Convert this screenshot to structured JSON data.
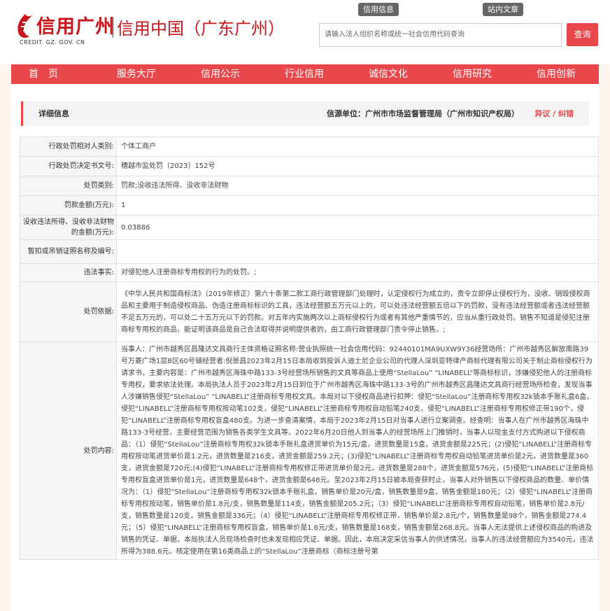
{
  "header": {
    "logo_text": "信用广州",
    "logo_sub": "CREDIT. GZ. GOV. CN",
    "site_title": "信用中国（广东广州）",
    "pill_left": "信用信息",
    "pill_right": "站内文章",
    "search_placeholder": "请输入法人组织名称或统一社会信用代码查询",
    "search_button": "查询"
  },
  "nav": [
    "首　页",
    "服务大厅",
    "信用公示",
    "行业信用",
    "诚信文化",
    "信用研究",
    "信用创新"
  ],
  "detail": {
    "title": "详细信息",
    "source_label": "信源单位：广州市市场监督管理局（广州市知识产权局）",
    "objection": "异议 / 纠错"
  },
  "rows": [
    {
      "label": "行政处罚相对人类别:",
      "value": "个体工商户"
    },
    {
      "label": "行政处罚决定书文号:",
      "value": "穗越市监处罚〔2023〕152号"
    },
    {
      "label": "处罚类别:",
      "value": "罚款;没收违法所得、没收非法财物"
    },
    {
      "label": "罚款金额(万元):",
      "value": "1"
    },
    {
      "label": "没收违法所得、没收非法财物的金额(万元):",
      "value": "0.03886"
    },
    {
      "label": "暂扣或吊销证照名称及编号:",
      "value": ""
    },
    {
      "label": "违法事实:",
      "value": "对侵犯他人注册商标专用权的行为的处罚。;"
    },
    {
      "label": "处罚依据:",
      "value": "《中华人民共和国商标法》（2019年修正）第六十条第二款工商行政管理部门处理时，认定侵权行为成立的，责令立即停止侵权行为，没收、销毁侵权商品和主要用于制造侵权商品、伪造注册商标标识的工具，违法经营额五万元以上的，可以处违法经营额五倍以下的罚款，没有违法经营额或者违法经营额不足五万元的，可以处二十五万元以下的罚款。对五年内实施两次以上商标侵权行为或者有其他严重情节的，应当从重行政处罚。销售不知道是侵犯注册商标专用权的商品，能证明该商品是自己合法取得并说明提供者的，由工商行政管理部门责令停止销售。;"
    },
    {
      "label": "处罚内容:",
      "value": "当事人：广州市越秀区昌隆达文具商行主体资格证照名称:营业执照统一社会信用代码：92440101MA9UXW9Y36经营场所：广州市越秀区解放南路39号万菱广场1层B区60号铺经营者:倪景昌2023年2月15日本局收到投诉人迪士尼企业公司的代理人深圳亚特律产商标代理有限公司关于制止商标侵权行为请求书，主要内容是：广州市越秀区海珠中路133-3号经营场所销售的文具等商品上使用“StellaLou” “LINABELL”等商标标识，涉嫌侵犯他人的注册商标专用权，要求依法处理。本局执法人员于2023年2月15日到位于广州市越秀区海珠中路133-3号的广州市越秀区昌隆达文具商行经营场所检查，发现当事人涉嫌销售侵犯“StellaLou” “LINABELL”注册商标专用权文具。本局对以下侵权商品进行扣押：侵犯“StellaLou”注册商标专用权32k锁本手账礼盒6盒，侵犯“LINABELL”注册商标专用权按动笔102支，侵犯“LINABELL”注册商标专用权自动铅笔240支，侵犯“LINABELL”注册商标专用权修正带190个，侵犯“LINABELL”注册商标专用权盲盒480支。为进一步查清案情，本局于2023年2月15日对当事人进行立案调查。经查明：当事人在广州市越秀区海珠中路133-3号经营，主要经营范围为销售各类学生文具等。2022年6月20日他人到当事人的经营场所上门推销时，当事人以现金支付方式购进以下侵权商品：（1）侵犯“StellaLou”注册商标专用权32k锁本手账礼盒进货单价为15元/盒，进货数量是15盒，进货金额是225元；(2)侵犯“LINABELL”注册商标专用权按动笔进货单价是1.2元，进货数量是216支，进货金额是259.2元；(3)侵犯“LINABELL”注册商标专用权自动铅笔进货单价是2元，进货数量是360支，进货金额是720元;(4)侵犯“LINABELL”注册商标专用权修正带进货单价是2元，进货数量是288个，进货金额是576元，(5)侵犯“LINABELL”注册商标专用权盲盒进货单价是1元，进货数量是648个，进货金额是648元。至2023年2月15日被本局查获时止，当事人对外销售以下侵权商品的数量、单价情况为：（1）侵犯“StellaLou”注册商标专用权32k锁本手账礼盒，销售单价是20元/盒，销售数量是9盒，销售金额是180元；（2）侵犯“LINABELL”注册商标专用权按动笔，销售单价是1.8元/支，销售数量是114支，销售金额是205.2元；（3）侵犯“LINABELL”注册商标专用权自动铅笔，销售单价是2.8元/支，销售数量是120支，销售金额是336元；（4）侵犯“LINABELL”注册商标专用权修正带，销售单价是2.8元/个，销售数量是98个，销售金额是274.4元；（5）侵犯“LINABELL”注册商标专用权盲盒，销售单价是1.6元/支，销售数量是168支，销售金额是268.8元。当事人无法提供上述侵权商品的购进及销售的凭证、单据，本局执法人员现场检查时也未发现相应凭证、单据。因此，本局决定采信当事人的供述情况，当事人的违法经营额应为3540元，违法所得为388.6元。核定使用在第16类商品上的“StellaLou”注册商标（商标注册号第"
    }
  ]
}
